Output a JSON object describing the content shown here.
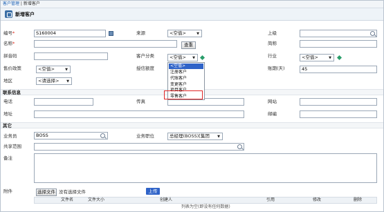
{
  "breadcrumb": {
    "root": "客户管理",
    "separator": " | ",
    "current": "新增客户"
  },
  "page": {
    "title": "新增客户"
  },
  "form": {
    "code": {
      "label": "编号",
      "value": "S160004"
    },
    "source": {
      "label": "来源",
      "value": "<空值>"
    },
    "superior": {
      "label": "上级",
      "value": ""
    },
    "name": {
      "label": "名称",
      "value": ""
    },
    "query_button": "查重",
    "short_name": {
      "label": "简称",
      "value": ""
    },
    "pinyin": {
      "label": "拼音码",
      "value": ""
    },
    "customer_category": {
      "label": "客户分类",
      "value": "<空值>"
    },
    "industry": {
      "label": "行业",
      "value": "<空值>"
    },
    "price_policy": {
      "label": "售价政策",
      "value": "<空值>"
    },
    "credit_limit": {
      "label": "授信额度",
      "value": ""
    },
    "account_period": {
      "label": "账期(天)",
      "value": "45"
    },
    "region": {
      "label": "地区",
      "value": "<请选择>"
    }
  },
  "contact_section": {
    "title": "联系信息",
    "phone": {
      "label": "电话",
      "value": ""
    },
    "fax": {
      "label": "传真",
      "value": ""
    },
    "website": {
      "label": "网站",
      "value": ""
    },
    "address": {
      "label": "地址",
      "value": ""
    },
    "postcode": {
      "label": "邮编",
      "value": ""
    }
  },
  "other_section": {
    "title": "其它",
    "salesperson": {
      "label": "业务员",
      "value": "BOSS"
    },
    "position": {
      "label": "业务职位",
      "value": "总经理(BOSS)[集团"
    },
    "share_scope": {
      "label": "共享范围",
      "value": ""
    },
    "remarks": {
      "label": "备注",
      "value": ""
    }
  },
  "attachments": {
    "label": "附件",
    "choose_file": "选择文件",
    "no_file": "没有选择文件",
    "upload": "上传",
    "columns": [
      "文件名",
      "文件大小",
      "创建人",
      "引用",
      "修改",
      "删除"
    ],
    "empty_message": "列表为空(即没有任何数据)"
  },
  "category_dropdown": {
    "options": [
      "<空值>",
      "注册客户",
      "代账客户",
      "变更客户",
      "项目客户",
      "零售客户"
    ],
    "selected_index": 0,
    "highlighted_index": 5
  },
  "colors": {
    "accent": "#2f63c8",
    "highlight_border": "#e02525",
    "required": "#d21"
  }
}
